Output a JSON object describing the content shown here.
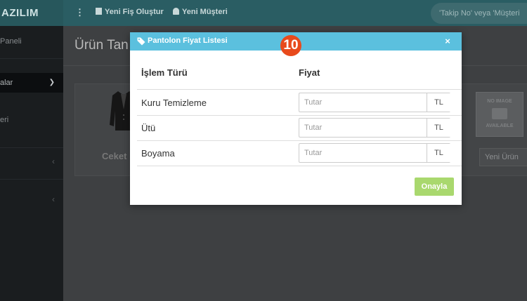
{
  "app": {
    "brand": "AZILIM",
    "topbar": {
      "menu_icon": "vertical-dots-icon",
      "new_receipt_label": "Yeni Fiş Oluştur",
      "new_customer_label": "Yeni Müşteri",
      "search_placeholder": "'Takip No' veya 'Müşteri"
    },
    "sidebar": {
      "items": [
        {
          "label": "Paneli"
        },
        {
          "label": "alar"
        },
        {
          "label": "eri"
        }
      ]
    },
    "page": {
      "title": "Ürün Tan",
      "product_label": "Ceket",
      "no_image_top": "NO IMAGE",
      "no_image_bottom": "AVAILABLE",
      "new_product_label": "Yeni Ürün"
    }
  },
  "modal": {
    "title": "Pantolon Fiyat Listesi",
    "title_icon": "tags-icon",
    "close_label": "×",
    "step_badge": "10",
    "columns": {
      "operation": "İşlem Türü",
      "price": "Fiyat"
    },
    "rows": [
      {
        "operation": "Kuru Temizleme",
        "price_value": "",
        "price_placeholder": "Tutar",
        "currency": "TL"
      },
      {
        "operation": "Ütü",
        "price_value": "",
        "price_placeholder": "Tutar",
        "currency": "TL"
      },
      {
        "operation": "Boyama",
        "price_value": "",
        "price_placeholder": "Tutar",
        "currency": "TL"
      }
    ],
    "confirm_label": "Onayla"
  },
  "colors": {
    "modal_header": "#5bc0de",
    "confirm_button": "#a9d86e",
    "step_badge": "#e84a1c",
    "topbar": "#2a5d63"
  }
}
